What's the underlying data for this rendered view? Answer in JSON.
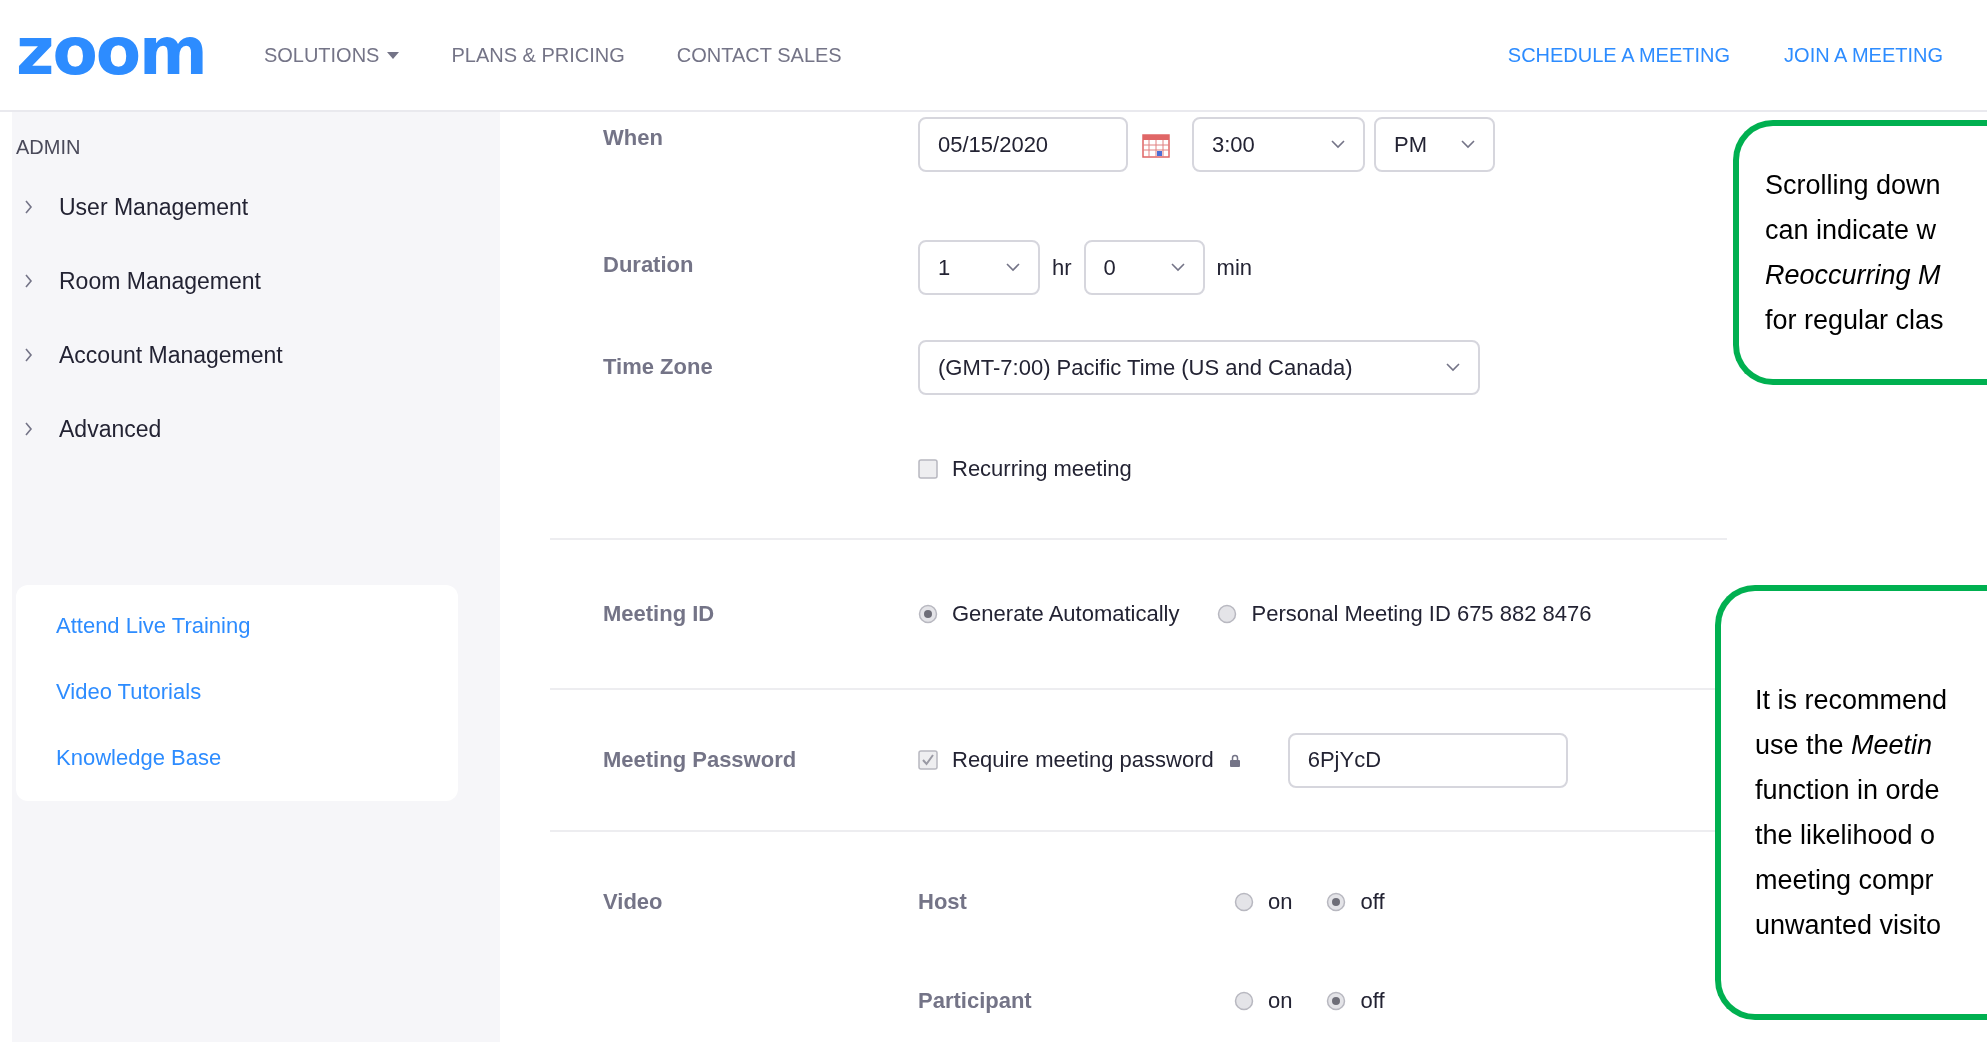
{
  "header": {
    "logo": "zoom",
    "nav": [
      {
        "label": "SOLUTIONS",
        "dropdown": true
      },
      {
        "label": "PLANS & PRICING",
        "dropdown": false
      },
      {
        "label": "CONTACT SALES",
        "dropdown": false
      }
    ],
    "actions": [
      "SCHEDULE A MEETING",
      "JOIN A MEETING"
    ]
  },
  "sidebar": {
    "heading": "ADMIN",
    "items": [
      {
        "label": "User Management",
        "expanded": false
      },
      {
        "label": "Room Management",
        "expanded": false
      },
      {
        "label": "Account Management",
        "expanded": false
      },
      {
        "label": "Advanced",
        "expanded": false
      }
    ],
    "links": [
      "Attend Live Training",
      "Video Tutorials",
      "Knowledge Base"
    ]
  },
  "form": {
    "when": {
      "label": "When",
      "date": "05/15/2020",
      "time": "3:00",
      "ampm": "PM"
    },
    "duration": {
      "label": "Duration",
      "hours": "1",
      "hours_unit": "hr",
      "minutes": "0",
      "minutes_unit": "min"
    },
    "time_zone": {
      "label": "Time Zone",
      "value": "(GMT-7:00) Pacific Time (US and Canada)"
    },
    "recurring": {
      "label": "Recurring meeting",
      "checked": false
    },
    "meeting_id": {
      "label": "Meeting ID",
      "options": [
        {
          "label": "Generate Automatically",
          "selected": true
        },
        {
          "label": "Personal Meeting ID 675 882 8476",
          "selected": false
        }
      ]
    },
    "password": {
      "label": "Meeting Password",
      "checkbox": {
        "label": "Require meeting password",
        "checked": true
      },
      "value": "6PjYcD"
    },
    "video": {
      "label": "Video",
      "rows": [
        {
          "label": "Host",
          "options": [
            {
              "label": "on",
              "selected": false
            },
            {
              "label": "off",
              "selected": true
            }
          ]
        },
        {
          "label": "Participant",
          "options": [
            {
              "label": "on",
              "selected": false
            },
            {
              "label": "off",
              "selected": true
            }
          ]
        }
      ]
    }
  },
  "callouts": [
    {
      "lines": [
        {
          "text": "Scrolling down",
          "italic": false
        },
        {
          "text": "can indicate w",
          "italic": false
        },
        {
          "text": "Reoccurring M",
          "italic": true
        },
        {
          "text": "for regular clas",
          "italic": false
        }
      ]
    },
    {
      "lines": [
        {
          "text": "It is recommend",
          "italic": false
        },
        {
          "text": "use the *Meetin*",
          "italic": false
        },
        {
          "text": "function in orde",
          "italic": false
        },
        {
          "text": "the likelihood o",
          "italic": false
        },
        {
          "text": "meeting compr",
          "italic": false
        },
        {
          "text": "unwanted visito",
          "italic": false
        }
      ]
    }
  ]
}
